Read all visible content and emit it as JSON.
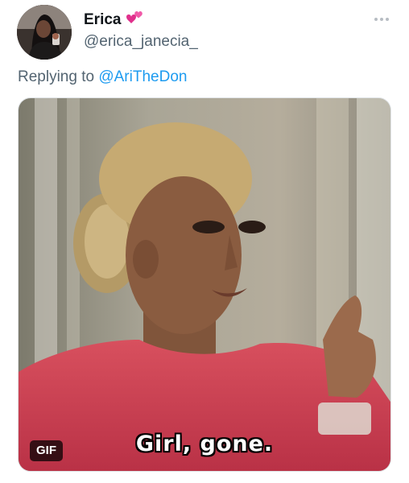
{
  "user": {
    "display_name": "Erica",
    "handle": "@erica_janecia_",
    "name_emoji": "two-hearts-icon",
    "avatar": "avatar"
  },
  "reply": {
    "prefix": "Replying to ",
    "to_handle": "@AriTheDon"
  },
  "media": {
    "caption": "Girl, gone.",
    "badge": "GIF"
  },
  "menu": {
    "icon": "more-icon"
  },
  "colors": {
    "name": "#0f1419",
    "secondary": "#536471",
    "link": "#1d9bf0",
    "heart": "#e0308c"
  }
}
